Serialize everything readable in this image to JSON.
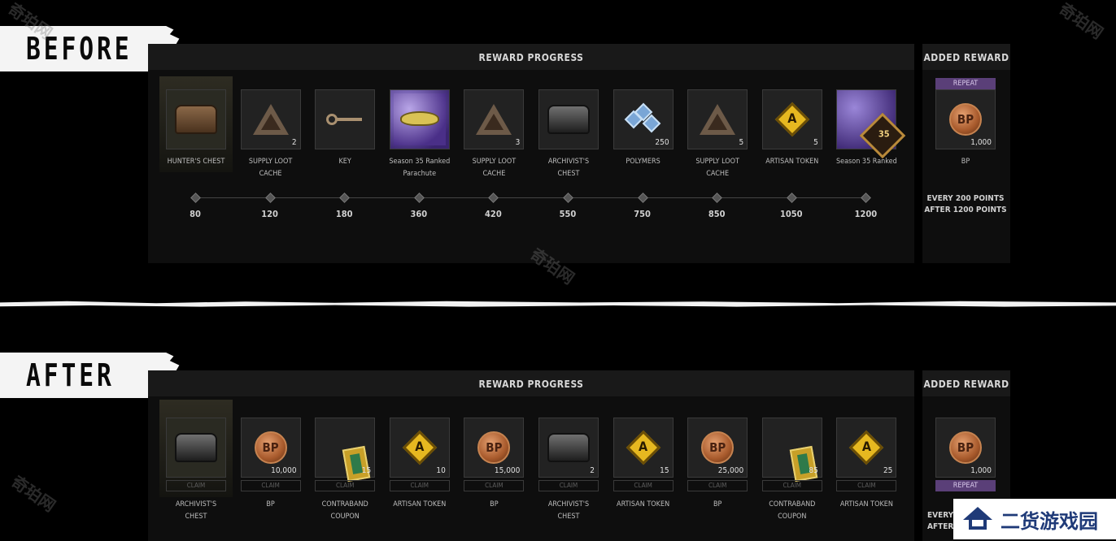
{
  "before": {
    "tag": "BEFORE",
    "progress_title": "REWARD PROGRESS",
    "added_title": "ADDED REWARD",
    "items": [
      {
        "label": "HUNTER'S CHEST",
        "qty": "",
        "points": "80",
        "icon": "hunters-chest-icon"
      },
      {
        "label": "SUPPLY LOOT\nCACHE",
        "qty": "2",
        "points": "120",
        "icon": "supply-loot-cache-icon"
      },
      {
        "label": "KEY",
        "qty": "",
        "points": "180",
        "icon": "key-icon"
      },
      {
        "label": "Season 35 Ranked\nParachute",
        "qty": "",
        "points": "360",
        "icon": "parachute-icon"
      },
      {
        "label": "SUPPLY LOOT\nCACHE",
        "qty": "3",
        "points": "420",
        "icon": "supply-loot-cache-icon"
      },
      {
        "label": "ARCHIVIST'S\nCHEST",
        "qty": "",
        "points": "550",
        "icon": "archivists-chest-icon"
      },
      {
        "label": "POLYMERS",
        "qty": "250",
        "points": "750",
        "icon": "polymers-icon"
      },
      {
        "label": "SUPPLY LOOT\nCACHE",
        "qty": "5",
        "points": "850",
        "icon": "supply-loot-cache-icon"
      },
      {
        "label": "ARTISAN TOKEN",
        "qty": "5",
        "points": "1050",
        "icon": "artisan-token-icon"
      },
      {
        "label": "Season 35 Ranked",
        "qty": "",
        "points": "1200",
        "icon": "ranked-medal-icon"
      }
    ],
    "added": {
      "badge": "REPEAT",
      "label": "BP",
      "qty": "1,000",
      "icon_text": "BP",
      "note": "EVERY 200 POINTS\nAFTER 1200 POINTS"
    }
  },
  "after": {
    "tag": "AFTER",
    "progress_title": "REWARD PROGRESS",
    "added_title": "ADDED REWARD",
    "claim_label": "CLAIM",
    "items": [
      {
        "label": "ARCHIVIST'S\nCHEST",
        "qty": "",
        "icon": "archivists-chest-icon"
      },
      {
        "label": "BP",
        "qty": "10,000",
        "icon": "bp-coin-icon"
      },
      {
        "label": "CONTRABAND\nCOUPON",
        "qty": "15",
        "icon": "contraband-coupon-icon"
      },
      {
        "label": "ARTISAN TOKEN",
        "qty": "10",
        "icon": "artisan-token-icon"
      },
      {
        "label": "BP",
        "qty": "15,000",
        "icon": "bp-coin-icon"
      },
      {
        "label": "ARCHIVIST'S\nCHEST",
        "qty": "2",
        "icon": "archivists-chest-icon"
      },
      {
        "label": "ARTISAN TOKEN",
        "qty": "15",
        "icon": "artisan-token-icon"
      },
      {
        "label": "BP",
        "qty": "25,000",
        "icon": "bp-coin-icon"
      },
      {
        "label": "CONTRABAND\nCOUPON",
        "qty": "85",
        "icon": "contraband-coupon-icon"
      },
      {
        "label": "ARTISAN TOKEN",
        "qty": "25",
        "icon": "artisan-token-icon"
      }
    ],
    "added": {
      "badge": "REPEAT",
      "qty": "1,000",
      "icon_text": "BP",
      "note": "EVERY\nAFTER"
    }
  },
  "watermark": "奇珀网",
  "site_logo": "二货游戏园",
  "icon_letters": {
    "artisan": "A",
    "bp": "BP",
    "ranked": "35"
  }
}
